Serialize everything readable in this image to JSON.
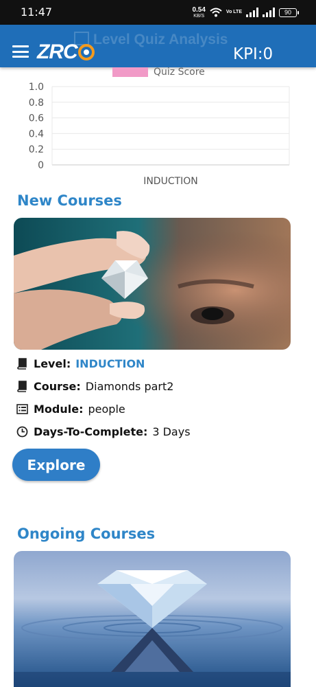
{
  "status_bar": {
    "time": "11:47",
    "net_speed": "0.54",
    "net_unit": "KB/S",
    "volte": "Vo LTE",
    "battery": "90"
  },
  "header": {
    "title": "Level Quiz Analysis",
    "logo": "ZRCO",
    "kpi": "KPI:0"
  },
  "chart_data": {
    "type": "bar",
    "categories": [
      "INDUCTION"
    ],
    "series": [
      {
        "name": "Quiz Score",
        "values": [
          0
        ]
      }
    ],
    "ylim": [
      0,
      1.0
    ],
    "yticks": [
      "0",
      "0.2",
      "0.4",
      "0.6",
      "0.8",
      "1.0"
    ],
    "legend": "top",
    "color": "#f19ac7"
  },
  "new_courses": {
    "title": "New Courses",
    "level_label": "Level:",
    "level_value": "INDUCTION",
    "course_label": "Course:",
    "course_value": "Diamonds part2",
    "module_label": "Module:",
    "module_value": "people",
    "days_label": "Days-To-Complete:",
    "days_value": "3 Days",
    "explore_label": "Explore"
  },
  "ongoing_courses": {
    "title": "Ongoing Courses"
  },
  "colors": {
    "header": "#1f6eb8",
    "accent": "#2f86c8",
    "button": "#2f7ec7",
    "logo_orange": "#f39a1e"
  }
}
